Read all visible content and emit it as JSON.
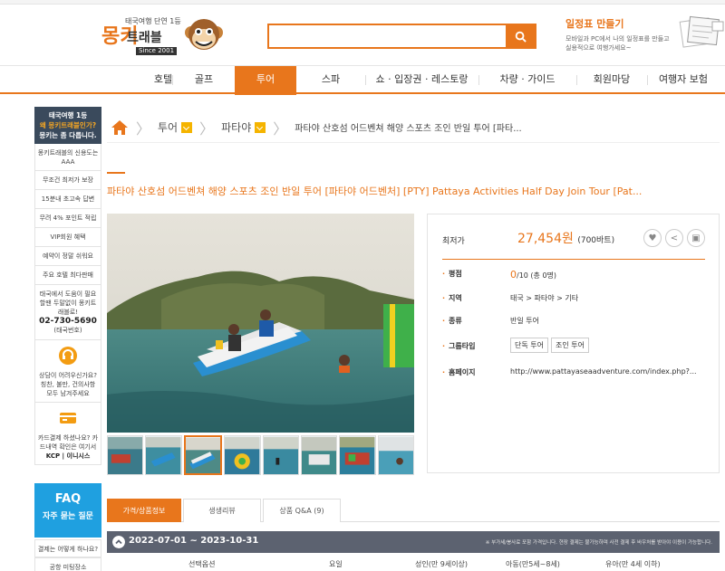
{
  "header": {
    "logo_tagline": "태국여행 단연 1등",
    "logo_main": "몽키",
    "logo_sub": "트래블",
    "logo_since": "Since 2001",
    "search_placeholder": "",
    "promo_title": "일정표 만들기",
    "promo_desc": "모바일과 PC에서 나의 일정표를 만들고 실용적으로 여행가세요~"
  },
  "nav": {
    "items": [
      "호텔",
      "골프",
      "투어",
      "스파",
      "쇼 · 입장권 · 레스토랑",
      "차량 · 가이드",
      "회원마당",
      "여행자 보험"
    ],
    "active": "투어"
  },
  "sidebar": {
    "top_line1": "태국여행 1등",
    "top_line2": "왜 몽키트래블인가?",
    "top_line3": "몽키는 좀 다릅니다.",
    "items": [
      "몽키트래블의 신용도는 AAA",
      "무조건 최저가 보장",
      "15분내 초고속 답변",
      "무려 4% 포인트 적립",
      "VIP회원 혜택",
      "예약이 정말 쉬워요",
      "주요 호텔 최다판매"
    ],
    "contact_text": "태국에서 도움이 필요할땐 두말없이 몽키트래블로!",
    "contact_phone": "02-730-5690",
    "contact_note": "(태국번호)",
    "consult_text": "상담이 어려우신가요? 칭찬, 불만, 건의사항 모두 남겨주세요",
    "card_text": "카드결제 하셨나요? 카드내역 확인은 여기서",
    "card_kcp": "KCP | 이니시스",
    "faq_title": "FAQ",
    "faq_sub": "자주 묻는 질문",
    "faq_items": [
      "결제는 어떻게 하나요?",
      "공항 미팅장소"
    ]
  },
  "breadcrumb": {
    "level1": "투어",
    "level2": "파타야",
    "current": "파타야 산호섬 어드벤쳐 해양 스포츠 조인 반일 투어 [파타..."
  },
  "product": {
    "title": "파타야 산호섬 어드벤쳐 해양 스포츠 조인 반일 투어 [파타야 어드벤처]   [PTY] Pattaya Activities Half Day Join Tour [Pat...",
    "price_label": "최저가",
    "price_value": "27,454원",
    "price_thb": "(700바트)",
    "rating_label": "평점",
    "rating_value": "0",
    "rating_scale": "/10 (총 0명)",
    "region_label": "지역",
    "region_value": "태국 > 파타야 > 기타",
    "type_label": "종류",
    "type_value": "반일 투어",
    "group_label": "그룹타입",
    "group_tags": [
      "단독 투어",
      "조인 투어"
    ],
    "homepage_label": "홈페이지",
    "homepage_value": "http://www.pattayaseaadventure.com/index.php?..."
  },
  "tabs": {
    "items": [
      "가격/상품정보",
      "생생리뷰",
      "상품 Q&A (9)"
    ],
    "active": "가격/상품정보"
  },
  "period": {
    "dates": "2022-07-01 ~ 2023-10-31",
    "note": "※ 부가세/봉사료 포함 가격입니다. 현장 결제는 불가능하며 사전 결제 후 바우처를 받아야 이용이 가능합니다."
  },
  "price_table": {
    "headers": [
      "선택옵션",
      "요일",
      "성인(만 9세이상)",
      "아동(만5세~8세)",
      "유아(만 4세 이하)"
    ]
  },
  "colors": {
    "accent": "#e8761c",
    "sidebar_dark": "#3a4a5c",
    "faq_blue": "#1fa0e0",
    "period_bar": "#5c6270"
  }
}
